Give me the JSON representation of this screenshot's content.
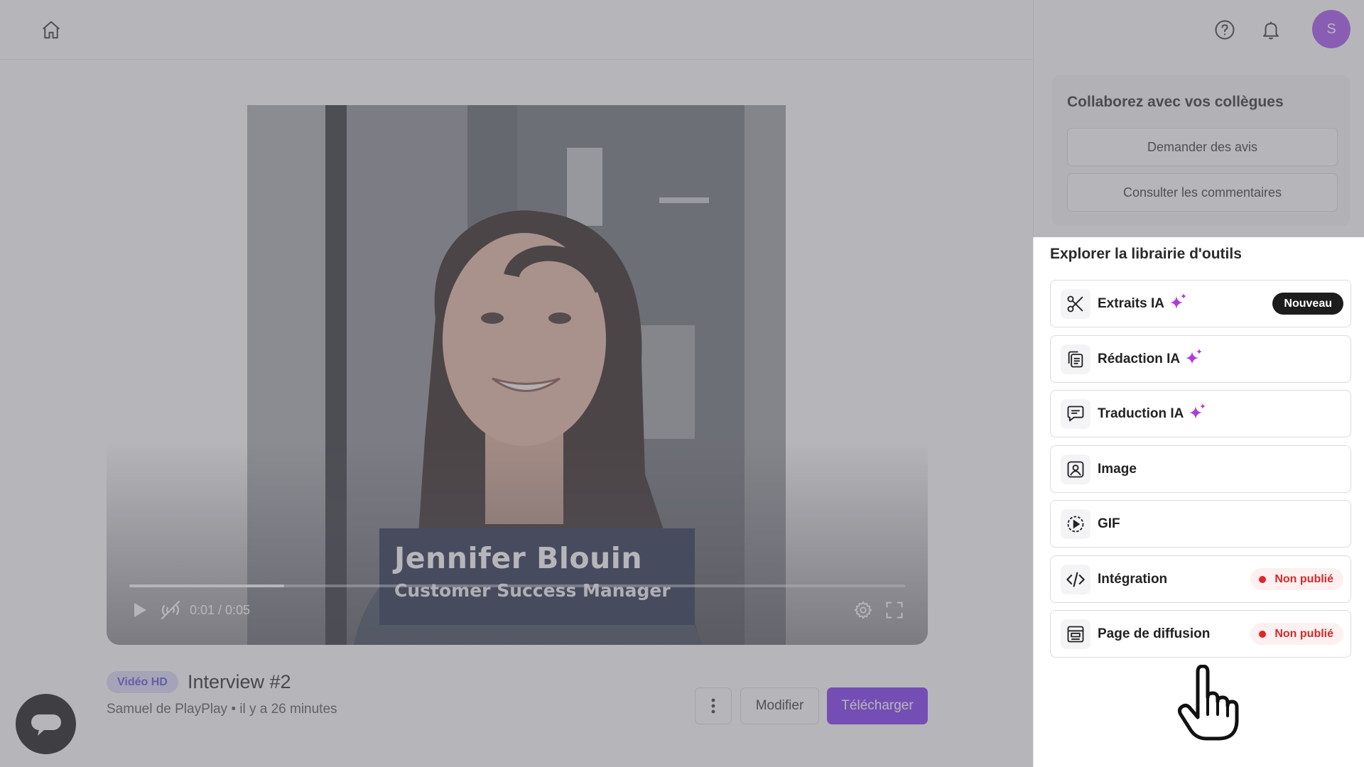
{
  "player": {
    "lower_third_name": "Jennifer Blouin",
    "lower_third_role": "Customer Success Manager",
    "time": "0:01 / 0:05",
    "progress": 0.2
  },
  "video_info": {
    "badge": "Vidéo HD",
    "title": "Interview #2",
    "meta": "Samuel de PlayPlay • il y a 26 minutes"
  },
  "actions": {
    "edit_label": "Modifier",
    "download_label": "Télécharger"
  },
  "user": {
    "avatar_initial": "S"
  },
  "collab": {
    "title": "Collaborez avec vos collègues",
    "request_label": "Demander des avis",
    "comments_label": "Consulter les commentaires"
  },
  "library": {
    "title": "Explorer la librairie d'outils",
    "tools": [
      {
        "label": "Extraits IA",
        "icon": "scissors-icon",
        "tag": "Nouveau"
      },
      {
        "label": "Rédaction IA",
        "icon": "documents-icon"
      },
      {
        "label": "Traduction IA",
        "icon": "chat-icon"
      },
      {
        "label": "Image",
        "icon": "image-icon"
      },
      {
        "label": "GIF",
        "icon": "gif-play-icon"
      },
      {
        "label": "Intégration",
        "icon": "code-icon",
        "tag": "Non publié"
      },
      {
        "label": "Page de diffusion",
        "icon": "web-page-icon",
        "tag": "Non publié"
      }
    ]
  },
  "colors": {
    "accent": "#7b2ff2",
    "avatar": "#a64cf4",
    "ai_sparkle": "#b03ad8",
    "unpublished": "#e0262b",
    "lower_third": "#1f2b47"
  }
}
